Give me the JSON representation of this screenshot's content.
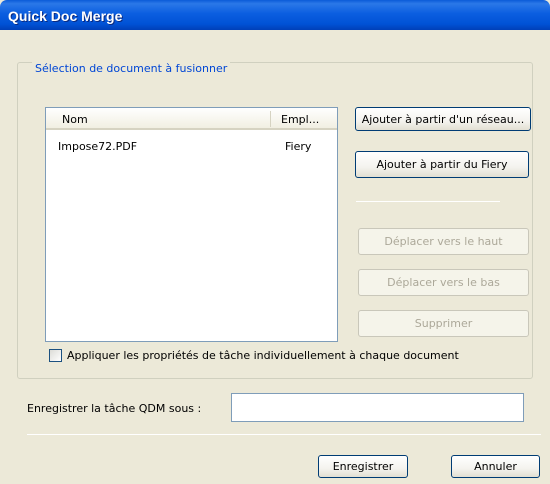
{
  "window": {
    "title": "Quick Doc Merge"
  },
  "group": {
    "legend": "Sélection de document à fusionner"
  },
  "list": {
    "columns": [
      "Nom",
      "Empl..."
    ],
    "rows": [
      {
        "name": "Impose72.PDF",
        "location": "Fiery"
      }
    ]
  },
  "buttons": {
    "add_network": "Ajouter à partir d'un réseau...",
    "add_fiery": "Ajouter à partir du Fiery",
    "move_up": "Déplacer vers le haut",
    "move_down": "Déplacer vers le bas",
    "delete": "Supprimer",
    "save": "Enregistrer",
    "cancel": "Annuler"
  },
  "options": {
    "apply_properties_label": "Appliquer les propriétés de tâche individuellement à chaque document",
    "apply_properties_checked": false
  },
  "save_as": {
    "label": "Enregistrer la tâche QDM sous :",
    "value": ""
  }
}
